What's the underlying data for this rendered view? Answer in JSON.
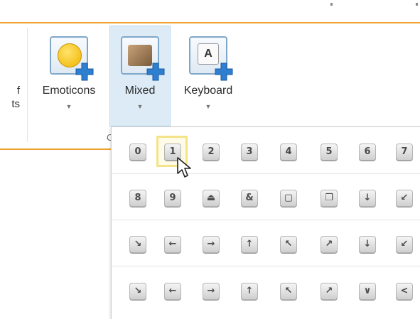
{
  "ribbon": {
    "cut_label": "f\nts",
    "group_label": "C",
    "buttons": [
      {
        "label": "Emoticons",
        "arrow": "▼",
        "icon": "smiley-icon"
      },
      {
        "label": "Mixed",
        "arrow": "▼",
        "icon": "box-icon"
      },
      {
        "label": "Keyboard",
        "arrow": "▼",
        "icon": "keycap-icon",
        "keycap_text": "A"
      }
    ]
  },
  "dropdown": {
    "rows": [
      [
        "0",
        "1",
        "2",
        "3",
        "4",
        "5",
        "6",
        "7"
      ],
      [
        "8",
        "9",
        "⏏",
        "&",
        "▢",
        "❐",
        "↓",
        "↙"
      ],
      [
        "↘",
        "←",
        "→",
        "↑",
        "↖",
        "↗",
        "↓",
        "↙"
      ],
      [
        "↘",
        "←",
        "→",
        "↑",
        "↖",
        "↗",
        "∨",
        "<"
      ]
    ],
    "hovered": {
      "row": 0,
      "col": 1
    }
  },
  "colors": {
    "accent": "#f0a12a",
    "selected_bg": "#dcebf6",
    "hover": "#f5e38a"
  }
}
